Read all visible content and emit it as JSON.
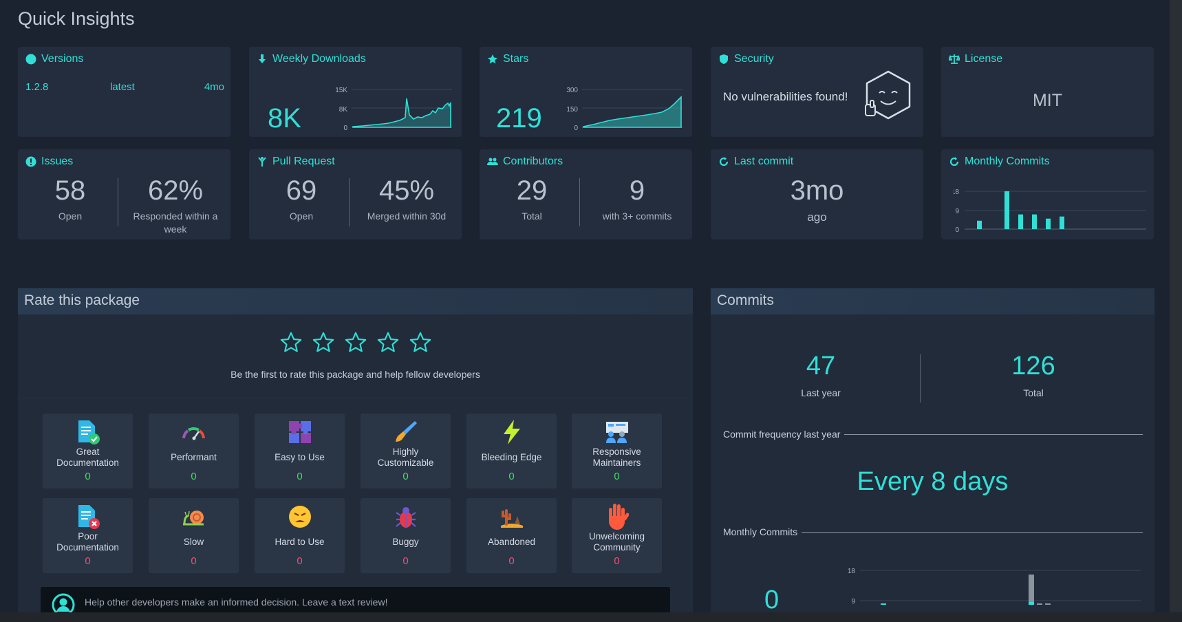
{
  "page_title": "Quick Insights",
  "versions": {
    "title": "Versions",
    "version": "1.2.8",
    "tag": "latest",
    "age": "4mo"
  },
  "downloads": {
    "title": "Weekly Downloads",
    "value": "8K",
    "ticks": [
      "15K",
      "8K",
      "0"
    ]
  },
  "stars": {
    "title": "Stars",
    "value": "219",
    "ticks": [
      "300",
      "150",
      "0"
    ]
  },
  "security": {
    "title": "Security",
    "message": "No vulnerabilities found!"
  },
  "license": {
    "title": "License",
    "value": "MIT"
  },
  "issues": {
    "title": "Issues",
    "open": "58",
    "open_label": "Open",
    "responded": "62%",
    "responded_label": "Responded within a week"
  },
  "pulls": {
    "title": "Pull Request",
    "open": "69",
    "open_label": "Open",
    "merged": "45%",
    "merged_label": "Merged within 30d"
  },
  "contributors": {
    "title": "Contributors",
    "total": "29",
    "total_label": "Total",
    "active": "9",
    "active_label": "with 3+ commits"
  },
  "last_commit": {
    "title": "Last commit",
    "value": "3mo",
    "label": "ago"
  },
  "monthly_commits": {
    "title": "Monthly Commits",
    "ticks": [
      "18",
      "9",
      "0"
    ],
    "bars": [
      4,
      0,
      18,
      7,
      7,
      5,
      6
    ]
  },
  "rate": {
    "title": "Rate this package",
    "prompt": "Be the first to rate this package and help fellow developers",
    "positive": [
      {
        "label": "Great Documentation",
        "count": "0",
        "icon": "document-check-icon"
      },
      {
        "label": "Performant",
        "count": "0",
        "icon": "speedometer-icon"
      },
      {
        "label": "Easy to Use",
        "count": "0",
        "icon": "puzzle-icon"
      },
      {
        "label": "Highly Customizable",
        "count": "0",
        "icon": "paintbrush-icon"
      },
      {
        "label": "Bleeding Edge",
        "count": "0",
        "icon": "lightning-icon"
      },
      {
        "label": "Responsive Maintainers",
        "count": "0",
        "icon": "people-board-icon"
      }
    ],
    "negative": [
      {
        "label": "Poor Documentation",
        "count": "0",
        "icon": "document-x-icon"
      },
      {
        "label": "Slow",
        "count": "0",
        "icon": "snail-icon"
      },
      {
        "label": "Hard to Use",
        "count": "0",
        "icon": "angry-face-icon"
      },
      {
        "label": "Buggy",
        "count": "0",
        "icon": "bug-icon"
      },
      {
        "label": "Abandoned",
        "count": "0",
        "icon": "desert-icon"
      },
      {
        "label": "Unwelcoming Community",
        "count": "0",
        "icon": "raised-hand-icon"
      }
    ],
    "review_prompt": "Help other developers make an informed decision. Leave a text review!"
  },
  "commits": {
    "title": "Commits",
    "last_year": "47",
    "last_year_label": "Last year",
    "total": "126",
    "total_label": "Total",
    "frequency_label": "Commit frequency last year",
    "frequency": "Every 8 days",
    "monthly_label": "Monthly Commits",
    "current": "0",
    "ticks": [
      "18",
      "9"
    ]
  },
  "colors": {
    "accent": "#2fe0d6",
    "positive": "#3fe05a",
    "negative": "#ff4a6b",
    "card": "#232d3d"
  }
}
